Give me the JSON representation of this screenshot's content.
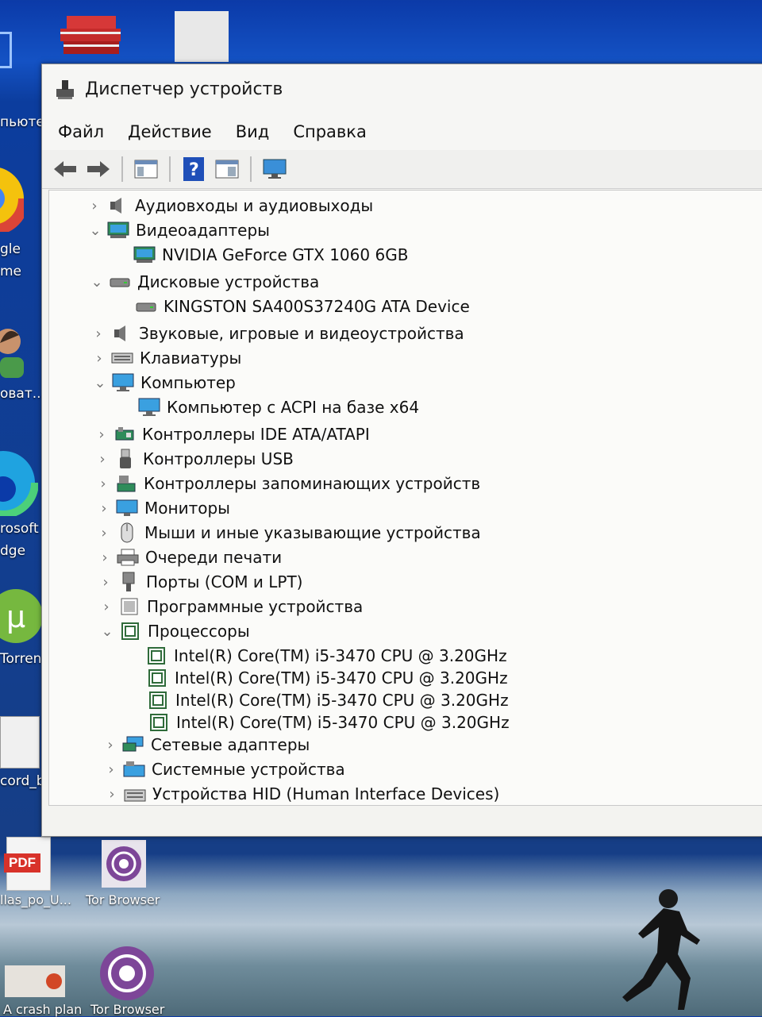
{
  "window": {
    "title": "Диспетчер устройств",
    "menu": [
      "Файл",
      "Действие",
      "Вид",
      "Справка"
    ]
  },
  "tree": [
    {
      "label": "Аудиовходы и аудиовыходы",
      "expanded": false,
      "icon": "speaker-icon",
      "children": []
    },
    {
      "label": "Видеоадаптеры",
      "expanded": true,
      "icon": "display-adapter-icon",
      "children": [
        "NVIDIA GeForce GTX 1060 6GB"
      ]
    },
    {
      "label": "Дисковые устройства",
      "expanded": true,
      "icon": "disk-drive-icon",
      "children": [
        "KINGSTON SA400S37240G ATA Device"
      ]
    },
    {
      "label": "Звуковые, игровые и видеоустройства",
      "expanded": false,
      "icon": "speaker-icon",
      "children": []
    },
    {
      "label": "Клавиатуры",
      "expanded": false,
      "icon": "keyboard-icon",
      "children": []
    },
    {
      "label": "Компьютер",
      "expanded": true,
      "icon": "computer-icon",
      "children": [
        "Компьютер с ACPI на базе x64"
      ]
    },
    {
      "label": "Контроллеры IDE ATA/ATAPI",
      "expanded": false,
      "icon": "ide-controller-icon",
      "children": []
    },
    {
      "label": "Контроллеры USB",
      "expanded": false,
      "icon": "usb-icon",
      "children": []
    },
    {
      "label": "Контроллеры запоминающих устройств",
      "expanded": false,
      "icon": "storage-controller-icon",
      "children": []
    },
    {
      "label": "Мониторы",
      "expanded": false,
      "icon": "monitor-icon",
      "children": []
    },
    {
      "label": "Мыши и иные указывающие устройства",
      "expanded": false,
      "icon": "mouse-icon",
      "children": []
    },
    {
      "label": "Очереди печати",
      "expanded": false,
      "icon": "printer-icon",
      "children": []
    },
    {
      "label": "Порты (COM и LPT)",
      "expanded": false,
      "icon": "port-icon",
      "children": []
    },
    {
      "label": "Программные устройства",
      "expanded": false,
      "icon": "software-device-icon",
      "children": []
    },
    {
      "label": "Процессоры",
      "expanded": true,
      "icon": "processor-icon",
      "children": [
        "Intel(R) Core(TM) i5-3470 CPU @ 3.20GHz",
        "Intel(R) Core(TM) i5-3470 CPU @ 3.20GHz",
        "Intel(R) Core(TM) i5-3470 CPU @ 3.20GHz",
        "Intel(R) Core(TM) i5-3470 CPU @ 3.20GHz"
      ]
    },
    {
      "label": "Сетевые адаптеры",
      "expanded": false,
      "icon": "network-adapter-icon",
      "children": []
    },
    {
      "label": "Системные устройства",
      "expanded": false,
      "icon": "system-device-icon",
      "children": []
    },
    {
      "label": "Устройства HID (Human Interface Devices)",
      "expanded": false,
      "icon": "hid-icon",
      "children": []
    }
  ],
  "desktop": {
    "left_labels": [
      "пьютер",
      "gle",
      "me",
      "оват...",
      "rosoft",
      "dge",
      "Torrent",
      "cord_ba..."
    ],
    "bottom_labels": [
      "llas_po_U...",
      "Tor Browser",
      "A crash plan",
      "Tor Browser"
    ],
    "pdf_badge": "PDF"
  }
}
